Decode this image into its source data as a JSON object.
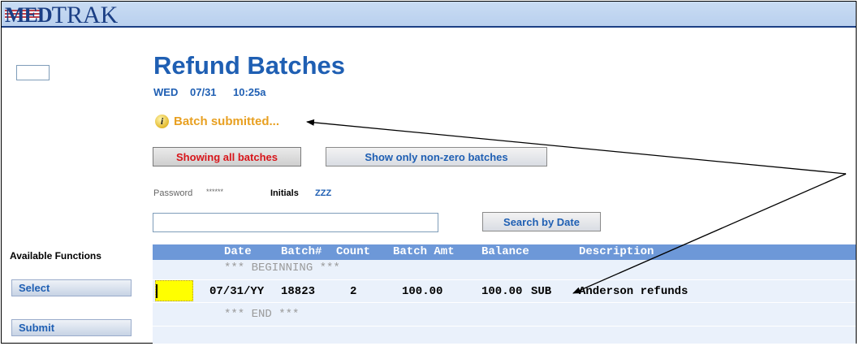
{
  "app": {
    "logo_med": "MED",
    "logo_trak": "TRAK"
  },
  "page": {
    "title": "Refund Batches",
    "day": "WED",
    "date": "07/31",
    "time": "10:25a",
    "message": "Batch submitted..."
  },
  "toolbar": {
    "showing_all": "Showing all batches",
    "show_nonzero": "Show only non-zero batches",
    "search_by_date": "Search by Date"
  },
  "credentials": {
    "password_label": "Password",
    "password_value": "******",
    "initials_label": "Initials",
    "initials_value": "ZZZ"
  },
  "search": {
    "value": ""
  },
  "sidebar": {
    "heading": "Available Functions",
    "functions": [
      "Select",
      "Submit"
    ]
  },
  "table": {
    "columns": [
      "Date",
      "Batch#",
      "Count",
      "Batch Amt",
      "Balance",
      "Description"
    ],
    "beginning": "*** BEGINNING ***",
    "end": "*** END ***",
    "rows": [
      {
        "date": "07/31/YY",
        "batch": "18823",
        "count": "2",
        "batch_amt": "100.00",
        "balance": "100.00",
        "status": "SUB",
        "description": "Anderson refunds"
      }
    ]
  },
  "colors": {
    "title_blue": "#1f5fb3",
    "message_orange": "#e8a021",
    "header_blue": "#6d98d8",
    "selected_yellow": "#ffff00",
    "red_button_text": "#d8161b"
  },
  "icons": {
    "message": "info-icon"
  }
}
